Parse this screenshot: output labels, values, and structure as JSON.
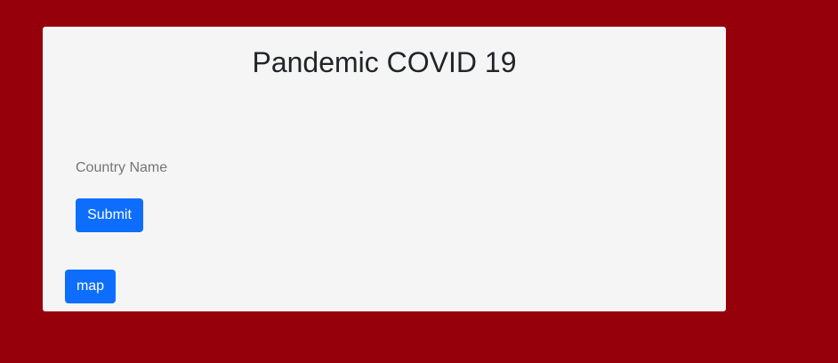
{
  "page": {
    "title": "Pandemic COVID 19"
  },
  "form": {
    "country_placeholder": "Country Name",
    "country_value": "",
    "submit_label": "Submit"
  },
  "actions": {
    "map_label": "map"
  },
  "colors": {
    "background": "#96000a",
    "card": "#f5f5f5",
    "button": "#0d6efd"
  }
}
